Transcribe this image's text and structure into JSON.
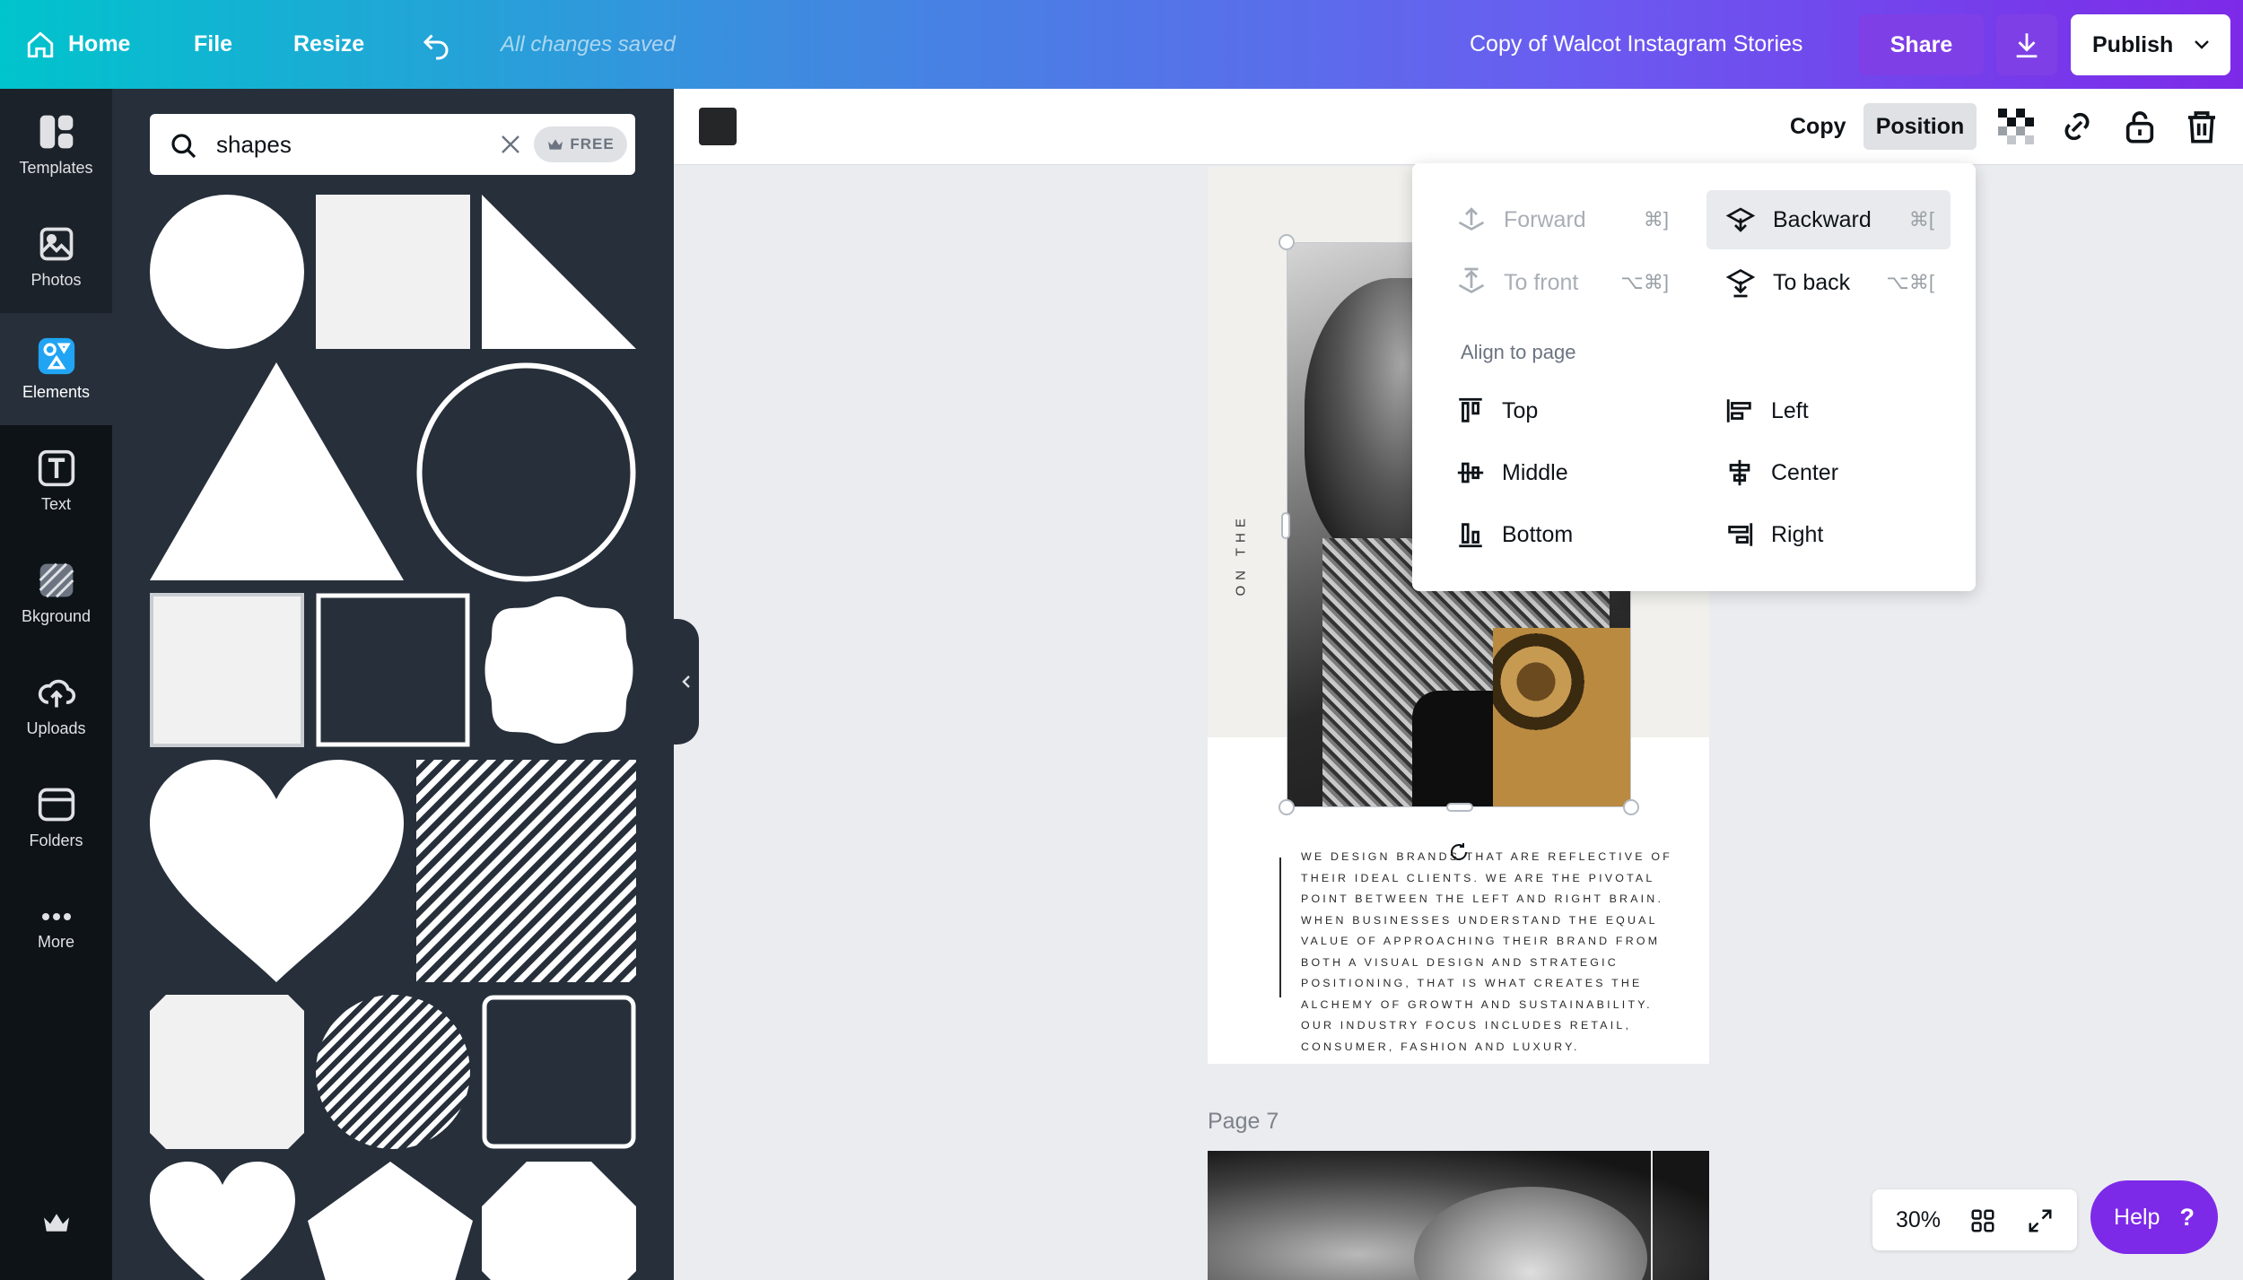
{
  "topbar": {
    "home_label": "Home",
    "file_label": "File",
    "resize_label": "Resize",
    "save_status": "All changes saved",
    "document_title": "Copy of Walcot Instagram Stories",
    "share_label": "Share",
    "publish_label": "Publish"
  },
  "rail": {
    "items": [
      {
        "label": "Templates",
        "icon": "templates-icon"
      },
      {
        "label": "Photos",
        "icon": "photos-icon"
      },
      {
        "label": "Elements",
        "icon": "elements-icon"
      },
      {
        "label": "Text",
        "icon": "text-icon"
      },
      {
        "label": "Bkground",
        "icon": "background-icon"
      },
      {
        "label": "Uploads",
        "icon": "uploads-icon"
      },
      {
        "label": "Folders",
        "icon": "folders-icon"
      },
      {
        "label": "More",
        "icon": "more-icon"
      }
    ],
    "active": "Elements"
  },
  "panel": {
    "search_value": "shapes",
    "free_badge": "FREE"
  },
  "toolbar": {
    "copy_label": "Copy",
    "position_label": "Position",
    "color_swatch": "#252627"
  },
  "position_menu": {
    "forward": {
      "label": "Forward",
      "shortcut": "⌘]"
    },
    "backward": {
      "label": "Backward",
      "shortcut": "⌘["
    },
    "to_front": {
      "label": "To front",
      "shortcut": "⌥⌘]"
    },
    "to_back": {
      "label": "To back",
      "shortcut": "⌥⌘["
    },
    "align_label": "Align to page",
    "top": "Top",
    "left": "Left",
    "middle": "Middle",
    "center": "Center",
    "bottom": "Bottom",
    "right": "Right"
  },
  "canvas": {
    "vertical_text": "ON THE",
    "body_text": "WE DESIGN BRANDS THAT ARE REFLECTIVE OF THEIR IDEAL CLIENTS. WE ARE THE PIVOTAL POINT BETWEEN THE LEFT AND RIGHT BRAIN. WHEN BUSINESSES UNDERSTAND THE EQUAL VALUE OF APPROACHING THEIR BRAND FROM BOTH A VISUAL DESIGN AND STRATEGIC POSITIONING, THAT IS WHAT CREATES THE ALCHEMY OF GROWTH AND SUSTAINABILITY. OUR INDUSTRY FOCUS INCLUDES RETAIL, CONSUMER, FASHION AND LUXURY.",
    "next_page_label": "Page 7"
  },
  "footer": {
    "zoom": "30%",
    "help_label": "Help",
    "help_icon": "?"
  },
  "colors": {
    "accent_purple": "#7d2ae8",
    "panel_bg": "#262f3a",
    "rail_bg": "#0e1318"
  }
}
